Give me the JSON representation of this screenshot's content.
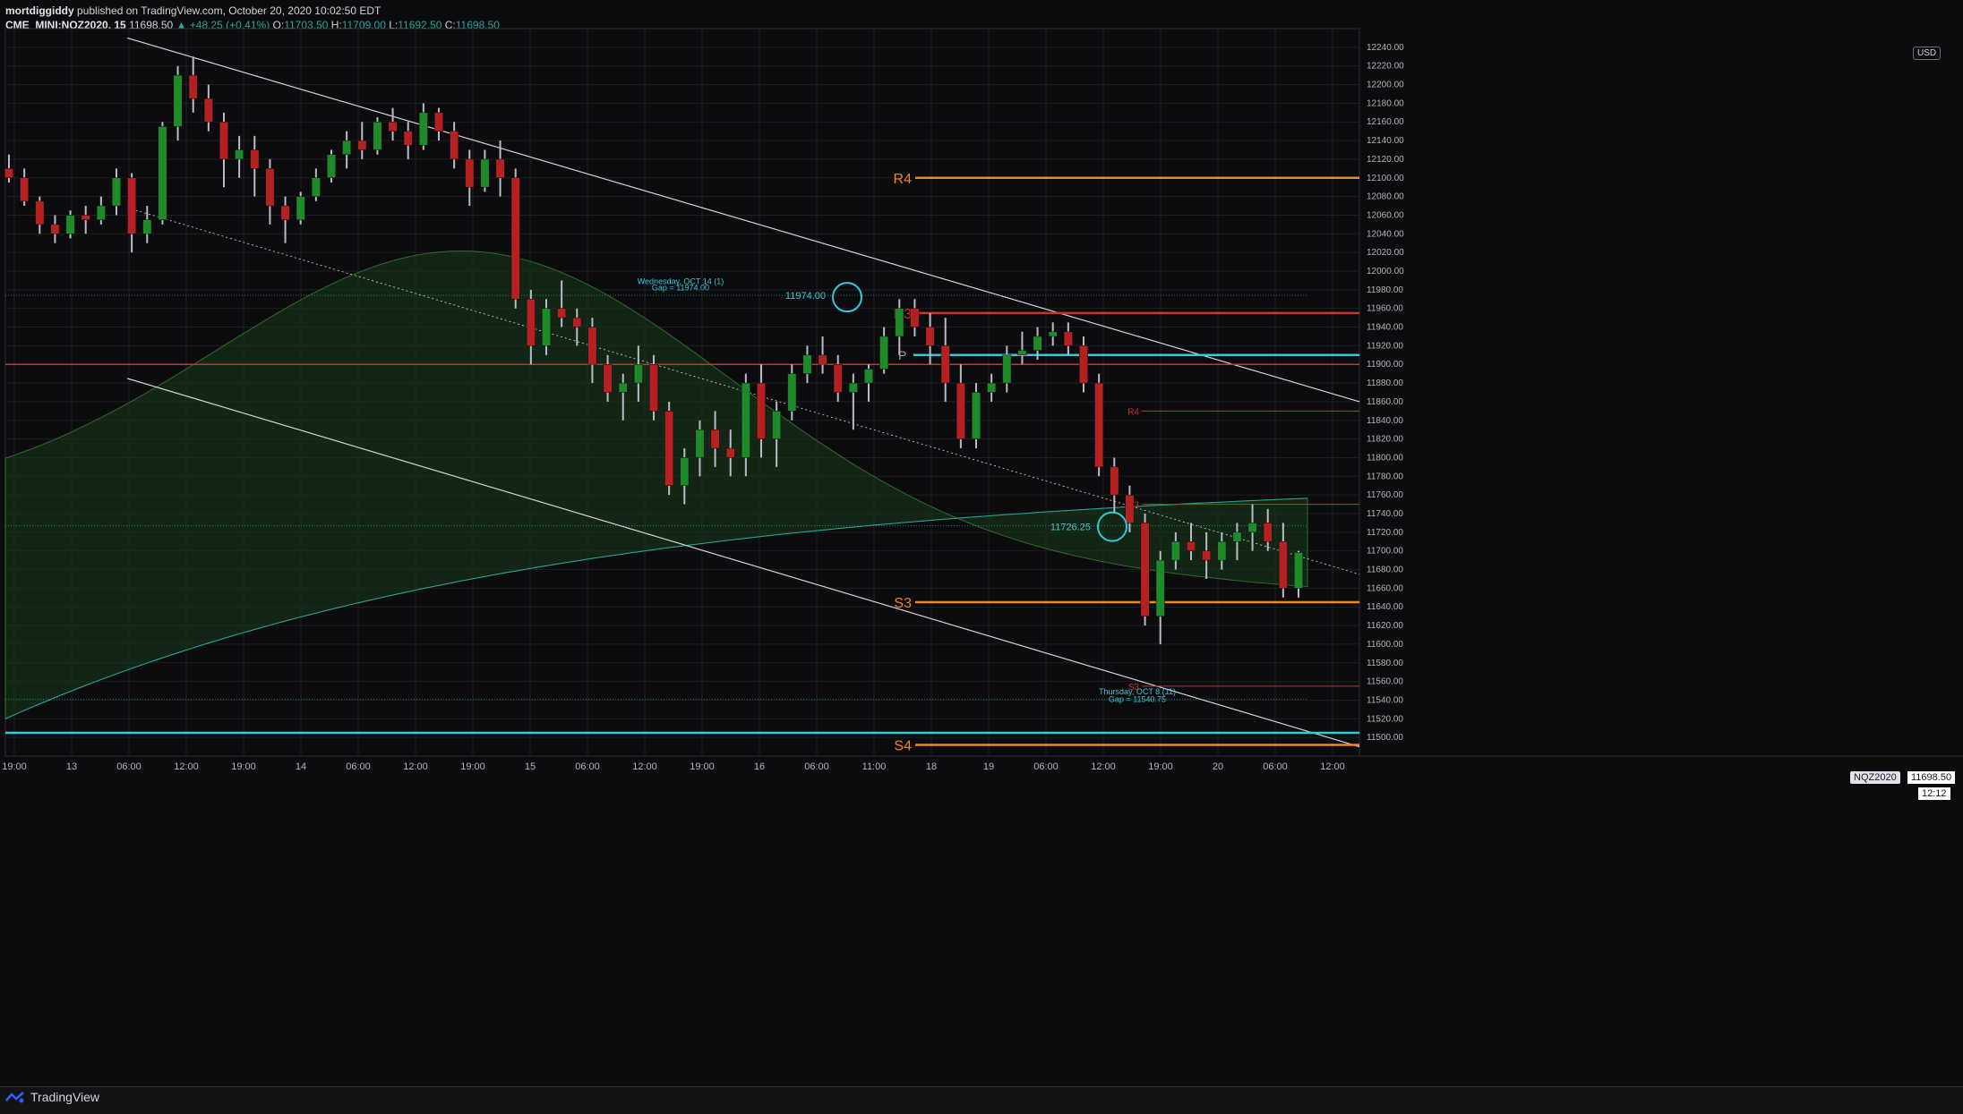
{
  "header": {
    "author": "mortdiggiddy",
    "published": "published on TradingView.com, October 20, 2020 10:02:50 EDT",
    "symbol": "CME_MINI:NQZ2020, 15",
    "last": "11698.50",
    "change": "▲ +48.25 (+0.41%)",
    "o_label": "O:",
    "o": "11703.50",
    "h_label": "H:",
    "h": "11709.00",
    "l_label": "L:",
    "l": "11692.50",
    "c_label": "C:",
    "c": "11698.50"
  },
  "footer": {
    "brand": "TradingView"
  },
  "price_axis": {
    "currency": "USD",
    "symbol_tag": "NQZ2020",
    "current_price": "11698.50",
    "countdown": "12:12"
  },
  "chart_data": {
    "type": "candlestick",
    "symbol": "NQZ2020",
    "interval": "15",
    "ylim": [
      11480,
      12260
    ],
    "y_ticks": [
      11500,
      11520,
      11540,
      11560,
      11580,
      11600,
      11620,
      11640,
      11660,
      11680,
      11700,
      11720,
      11740,
      11760,
      11780,
      11800,
      11820,
      11840,
      11860,
      11880,
      11900,
      11920,
      11940,
      11960,
      11980,
      12000,
      12020,
      12040,
      12060,
      12080,
      12100,
      12120,
      12140,
      12160,
      12180,
      12200,
      12220,
      12240
    ],
    "x_ticks": [
      "19:00",
      "13",
      "06:00",
      "12:00",
      "19:00",
      "14",
      "06:00",
      "12:00",
      "19:00",
      "15",
      "06:00",
      "12:00",
      "19:00",
      "16",
      "06:00",
      "11:00",
      "18",
      "19",
      "06:00",
      "12:00",
      "19:00",
      "20",
      "06:00",
      "12:00"
    ],
    "colors": {
      "up": "#1e8a2a",
      "down": "#b52020",
      "wick": "#b8bcc8",
      "background": "#0c0c0e",
      "grid": "#1c1f26",
      "pivot_orange": "#e8872c",
      "pivot_red": "#c0392b",
      "cyan": "#36c7d9"
    },
    "candles": [
      [
        12110,
        12125,
        12095,
        12100
      ],
      [
        12100,
        12110,
        12070,
        12075
      ],
      [
        12075,
        12080,
        12040,
        12050
      ],
      [
        12050,
        12060,
        12030,
        12040
      ],
      [
        12040,
        12065,
        12035,
        12060
      ],
      [
        12060,
        12070,
        12040,
        12055
      ],
      [
        12055,
        12080,
        12050,
        12070
      ],
      [
        12070,
        12110,
        12060,
        12100
      ],
      [
        12100,
        12105,
        12020,
        12040
      ],
      [
        12040,
        12070,
        12030,
        12055
      ],
      [
        12055,
        12160,
        12050,
        12155
      ],
      [
        12155,
        12220,
        12140,
        12210
      ],
      [
        12210,
        12230,
        12170,
        12185
      ],
      [
        12185,
        12200,
        12150,
        12160
      ],
      [
        12160,
        12170,
        12090,
        12120
      ],
      [
        12120,
        12145,
        12100,
        12130
      ],
      [
        12130,
        12145,
        12080,
        12110
      ],
      [
        12110,
        12120,
        12050,
        12070
      ],
      [
        12070,
        12080,
        12030,
        12055
      ],
      [
        12055,
        12085,
        12050,
        12080
      ],
      [
        12080,
        12110,
        12075,
        12100
      ],
      [
        12100,
        12130,
        12095,
        12125
      ],
      [
        12125,
        12150,
        12110,
        12140
      ],
      [
        12140,
        12160,
        12120,
        12130
      ],
      [
        12130,
        12165,
        12125,
        12160
      ],
      [
        12160,
        12175,
        12140,
        12150
      ],
      [
        12150,
        12160,
        12120,
        12135
      ],
      [
        12135,
        12180,
        12130,
        12170
      ],
      [
        12170,
        12175,
        12140,
        12150
      ],
      [
        12150,
        12160,
        12110,
        12120
      ],
      [
        12120,
        12130,
        12070,
        12090
      ],
      [
        12090,
        12130,
        12085,
        12120
      ],
      [
        12120,
        12140,
        12080,
        12100
      ],
      [
        12100,
        12110,
        11960,
        11970
      ],
      [
        11970,
        11980,
        11900,
        11920
      ],
      [
        11920,
        11970,
        11910,
        11960
      ],
      [
        11960,
        11990,
        11940,
        11950
      ],
      [
        11950,
        11960,
        11920,
        11940
      ],
      [
        11940,
        11950,
        11880,
        11900
      ],
      [
        11900,
        11910,
        11860,
        11870
      ],
      [
        11870,
        11890,
        11840,
        11880
      ],
      [
        11880,
        11920,
        11860,
        11900
      ],
      [
        11900,
        11910,
        11840,
        11850
      ],
      [
        11850,
        11860,
        11760,
        11770
      ],
      [
        11770,
        11810,
        11750,
        11800
      ],
      [
        11800,
        11840,
        11780,
        11830
      ],
      [
        11830,
        11850,
        11790,
        11810
      ],
      [
        11810,
        11830,
        11780,
        11800
      ],
      [
        11800,
        11890,
        11780,
        11880
      ],
      [
        11880,
        11900,
        11800,
        11820
      ],
      [
        11820,
        11860,
        11790,
        11850
      ],
      [
        11850,
        11900,
        11840,
        11890
      ],
      [
        11890,
        11920,
        11880,
        11910
      ],
      [
        11910,
        11930,
        11890,
        11900
      ],
      [
        11900,
        11910,
        11860,
        11870
      ],
      [
        11870,
        11890,
        11830,
        11880
      ],
      [
        11880,
        11900,
        11860,
        11895
      ],
      [
        11895,
        11940,
        11890,
        11930
      ],
      [
        11930,
        11970,
        11910,
        11960
      ],
      [
        11960,
        11970,
        11930,
        11940
      ],
      [
        11940,
        11955,
        11900,
        11920
      ],
      [
        11920,
        11950,
        11860,
        11880
      ],
      [
        11880,
        11900,
        11810,
        11820
      ],
      [
        11820,
        11880,
        11810,
        11870
      ],
      [
        11870,
        11890,
        11860,
        11880
      ],
      [
        11880,
        11920,
        11870,
        11910
      ],
      [
        11910,
        11935,
        11900,
        11915
      ],
      [
        11915,
        11940,
        11905,
        11930
      ],
      [
        11930,
        11945,
        11920,
        11935
      ],
      [
        11935,
        11945,
        11910,
        11920
      ],
      [
        11920,
        11930,
        11870,
        11880
      ],
      [
        11880,
        11890,
        11780,
        11790
      ],
      [
        11790,
        11800,
        11740,
        11760
      ],
      [
        11760,
        11770,
        11720,
        11730
      ],
      [
        11730,
        11740,
        11620,
        11630
      ],
      [
        11630,
        11700,
        11600,
        11690
      ],
      [
        11690,
        11720,
        11680,
        11710
      ],
      [
        11710,
        11730,
        11690,
        11700
      ],
      [
        11700,
        11720,
        11670,
        11690
      ],
      [
        11690,
        11720,
        11680,
        11710
      ],
      [
        11710,
        11730,
        11690,
        11720
      ],
      [
        11720,
        11750,
        11700,
        11730
      ],
      [
        11730,
        11745,
        11700,
        11710
      ],
      [
        11710,
        11730,
        11650,
        11660
      ],
      [
        11660,
        11700,
        11650,
        11698.5
      ]
    ],
    "pivot_levels": [
      {
        "label": "R4",
        "value": 12100
      },
      {
        "label": "R3",
        "value": 11955
      },
      {
        "label": "P",
        "value": 11910
      },
      {
        "label": "R4",
        "value": 11850
      },
      {
        "label": "R3",
        "value": 11750
      },
      {
        "label": "S3",
        "value": 11645
      },
      {
        "label": "S3",
        "value": 11555
      },
      {
        "label": "S4",
        "value": 11492
      }
    ],
    "horizontal_levels": [
      {
        "value": 11900,
        "style": "red"
      },
      {
        "value": 11910,
        "style": "cyan"
      },
      {
        "value": 11505,
        "style": "cyan"
      },
      {
        "value": 11727,
        "style": "teal-dotted"
      },
      {
        "value": 11974,
        "style": "teal-dotted"
      },
      {
        "value": 11541,
        "style": "teal-dotted"
      }
    ],
    "annotations": [
      {
        "text": "11974.00",
        "value": 11974
      },
      {
        "text": "Wednesday, OCT 14 (1)",
        "value": 11990
      },
      {
        "text": "Gap = 11974.00",
        "value": 11983
      },
      {
        "text": "11726.25",
        "value": 11726
      },
      {
        "text": "Thursday, OCT 8 (11)",
        "value": 11550
      },
      {
        "text": "Gap = 11540.75",
        "value": 11542
      }
    ]
  }
}
